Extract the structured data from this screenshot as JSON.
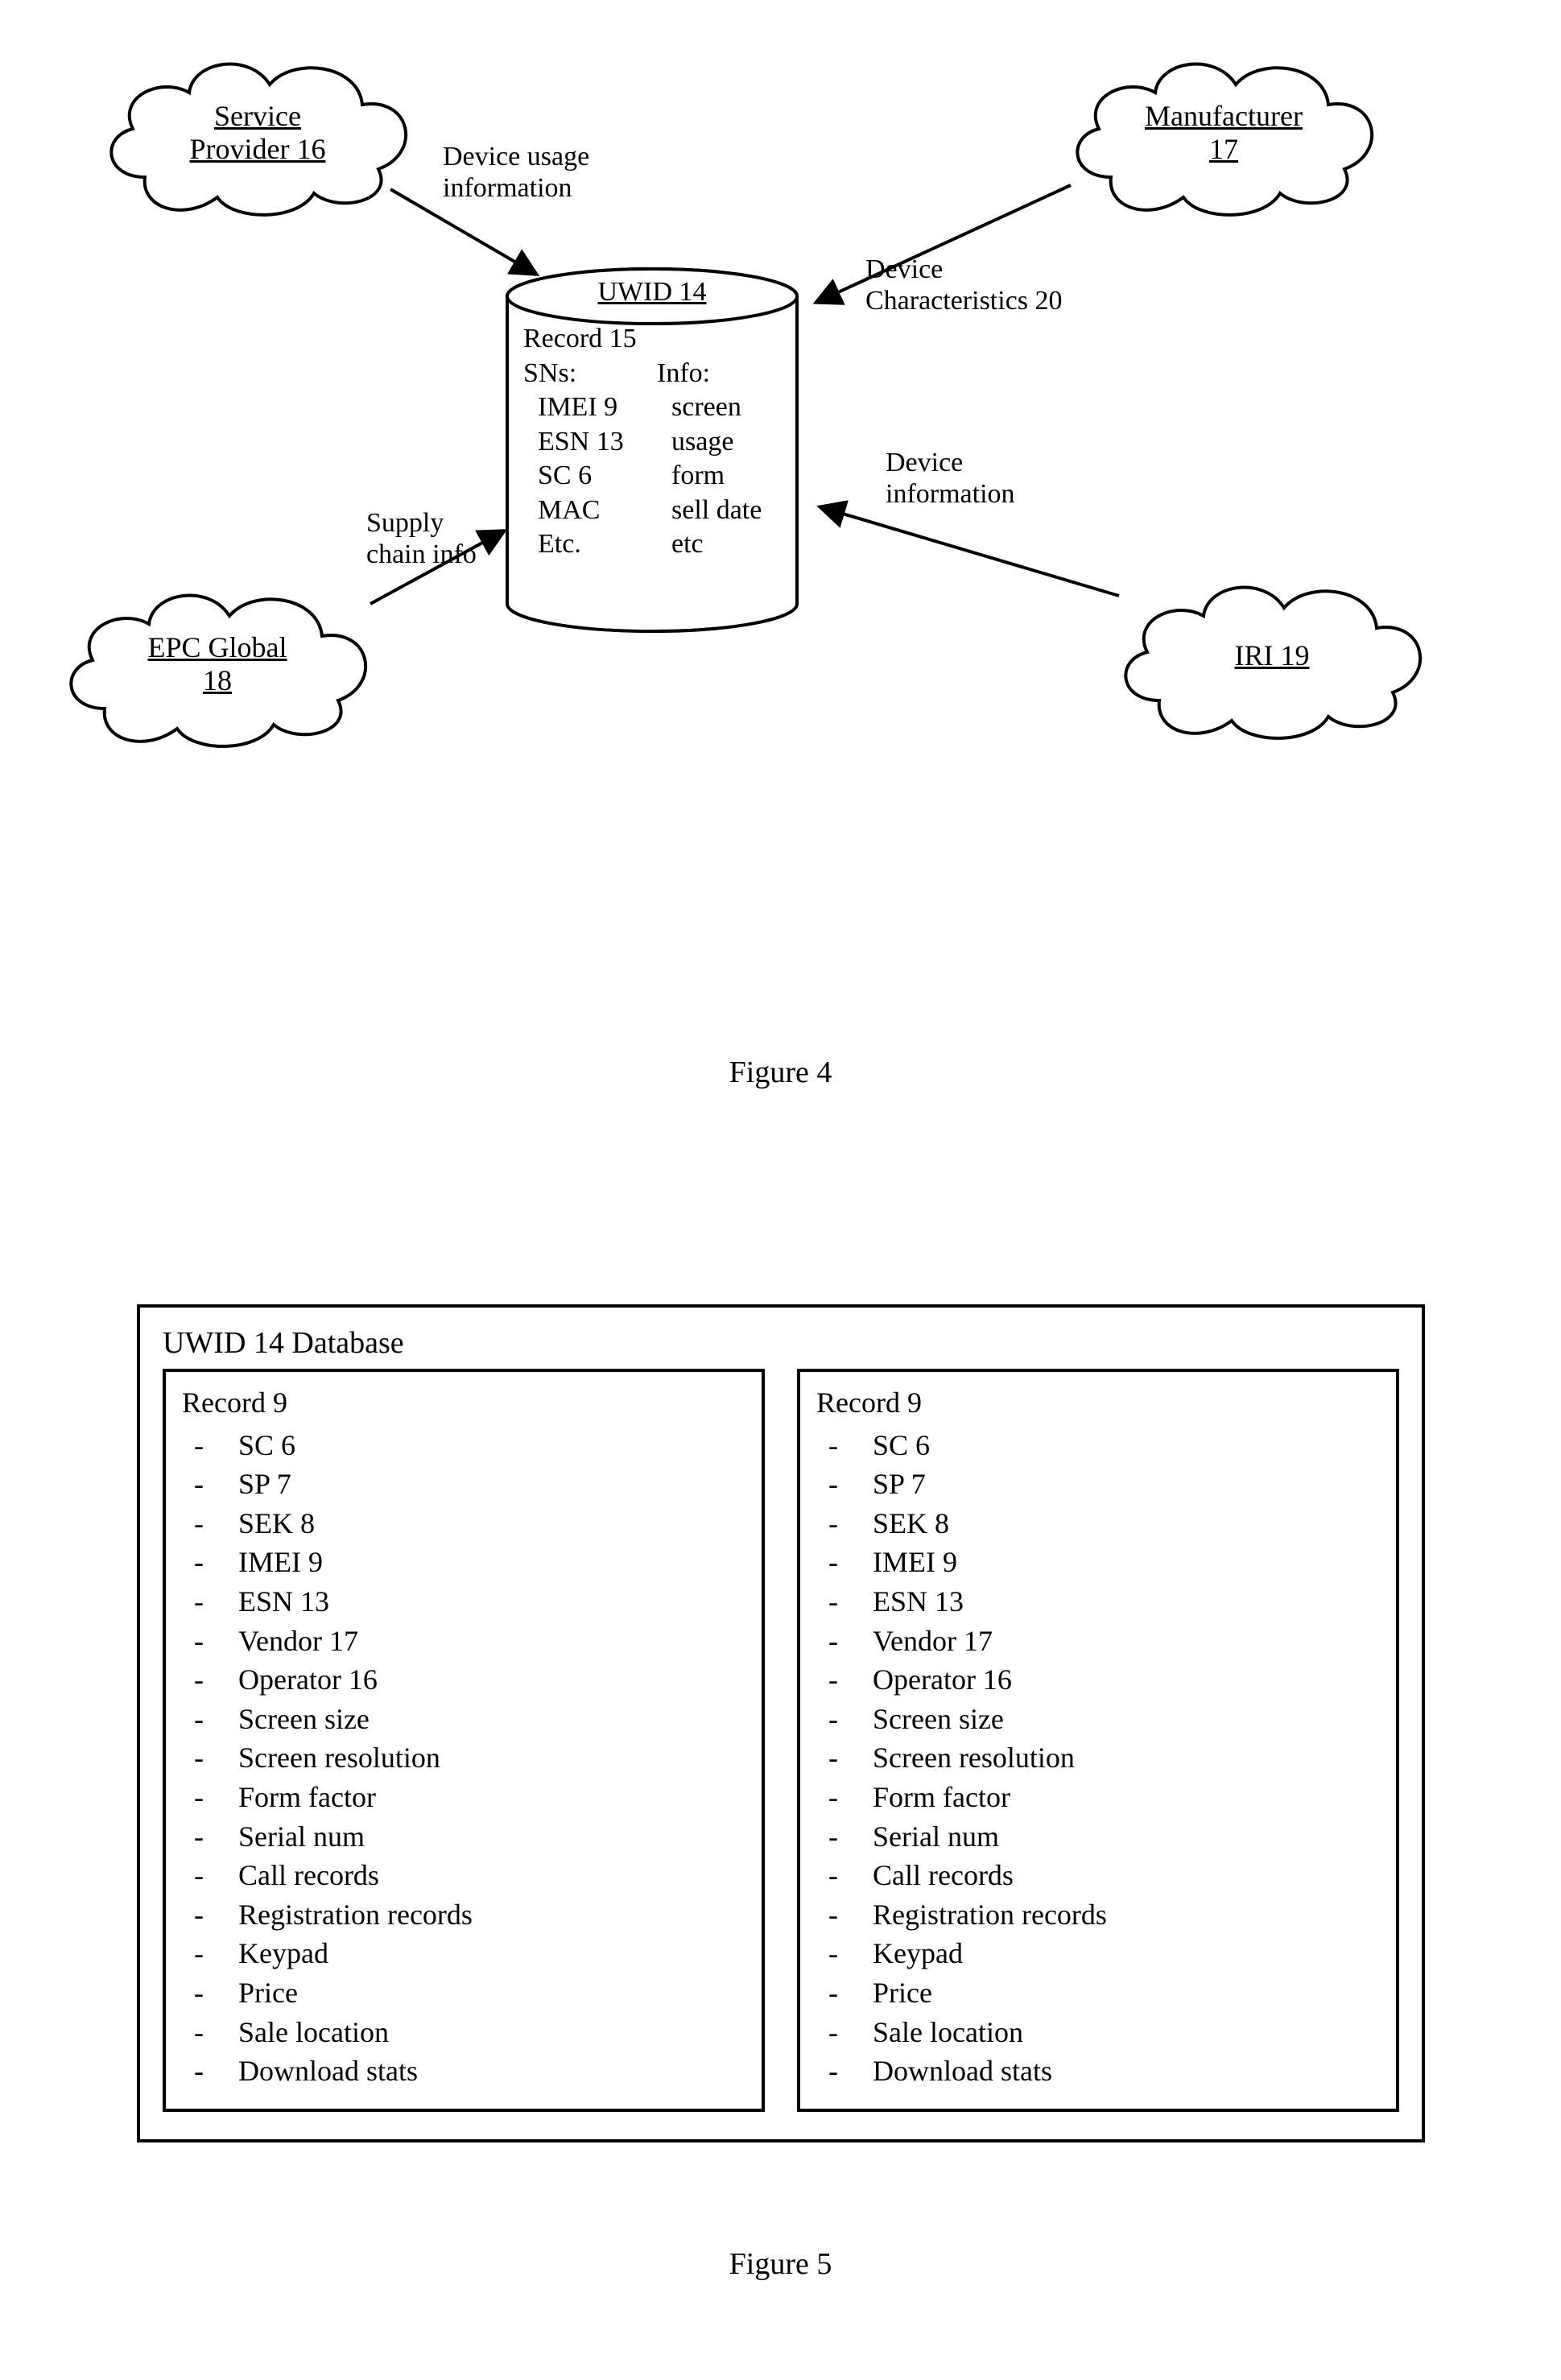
{
  "figure4": {
    "caption": "Figure 4",
    "clouds": {
      "serviceProvider": "Service\nProvider 16",
      "manufacturer": "Manufacturer\n17",
      "epcGlobal": "EPC Global\n18",
      "iri": "IRI 19"
    },
    "arrows": {
      "sp": "Device usage\ninformation",
      "mfr": "Device\nCharacteristics 20",
      "epc": "Supply\nchain info",
      "iri": "Device\ninformation"
    },
    "cylinder": {
      "title": "UWID 14",
      "recordLabel": "Record 15",
      "snsHdr": "SNs:",
      "infoHdr": "Info:",
      "sns": [
        "IMEI 9",
        "ESN 13",
        "SC 6",
        "MAC",
        "Etc."
      ],
      "info": [
        "screen",
        "usage",
        "form",
        "sell date",
        "etc"
      ]
    }
  },
  "figure5": {
    "caption": "Figure 5",
    "dbTitle": "UWID 14 Database",
    "recordTitle": "Record 9",
    "fields": [
      "SC 6",
      "SP 7",
      "SEK 8",
      "IMEI 9",
      "ESN 13",
      "Vendor 17",
      "Operator 16",
      "Screen size",
      "Screen resolution",
      "Form factor",
      "Serial num",
      "Call records",
      "Registration records",
      "Keypad",
      "Price",
      "Sale location",
      "Download stats"
    ]
  }
}
